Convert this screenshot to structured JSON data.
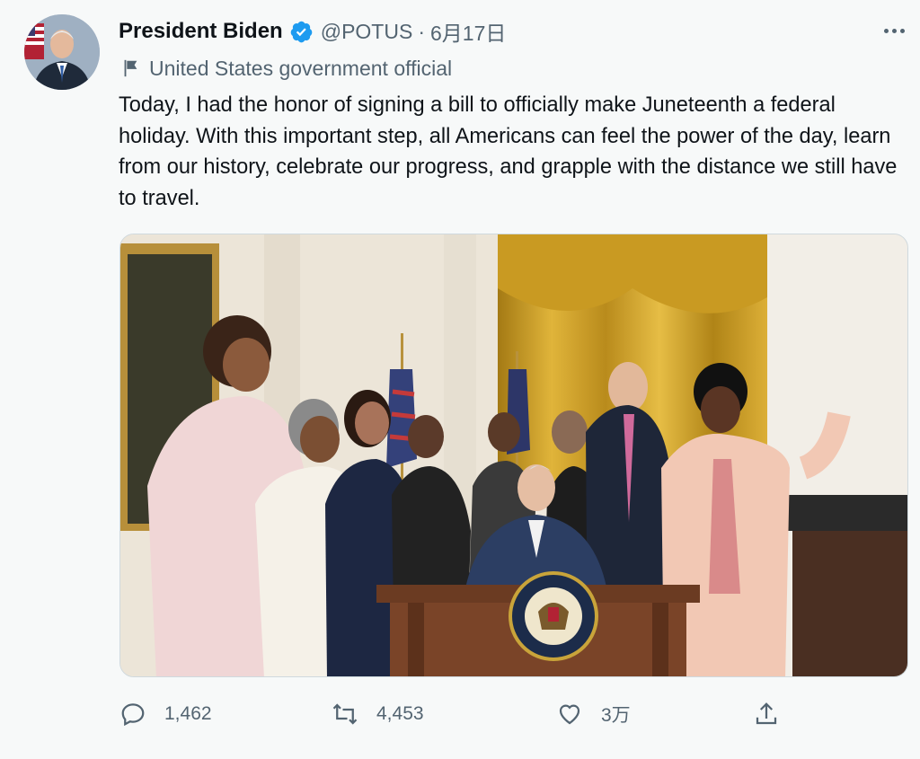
{
  "author": {
    "name": "President Biden",
    "handle": "@POTUS",
    "separator": "·",
    "date": "6月17日",
    "verified_icon": "verified-badge-icon",
    "avatar": "profile-photo"
  },
  "label": {
    "icon": "flag-icon",
    "text": "United States government official"
  },
  "tweet": {
    "text": "Today, I had the honor of signing a bill to officially make Juneteenth a federal holiday. With this important step, all Americans can feel the power of the day, learn from our history, celebrate our progress, and grapple with the distance we still have to travel."
  },
  "media": {
    "type": "photo",
    "description_icon": "photo-bill-signing"
  },
  "actions": {
    "reply": {
      "icon": "reply-icon",
      "count": "1,462"
    },
    "retweet": {
      "icon": "retweet-icon",
      "count": "4,453"
    },
    "like": {
      "icon": "heart-icon",
      "count": "3万"
    },
    "share": {
      "icon": "share-icon"
    }
  },
  "colors": {
    "background": "#f7f9f9",
    "text": "#0f1419",
    "secondary": "#536471",
    "verified": "#1d9bf0"
  }
}
